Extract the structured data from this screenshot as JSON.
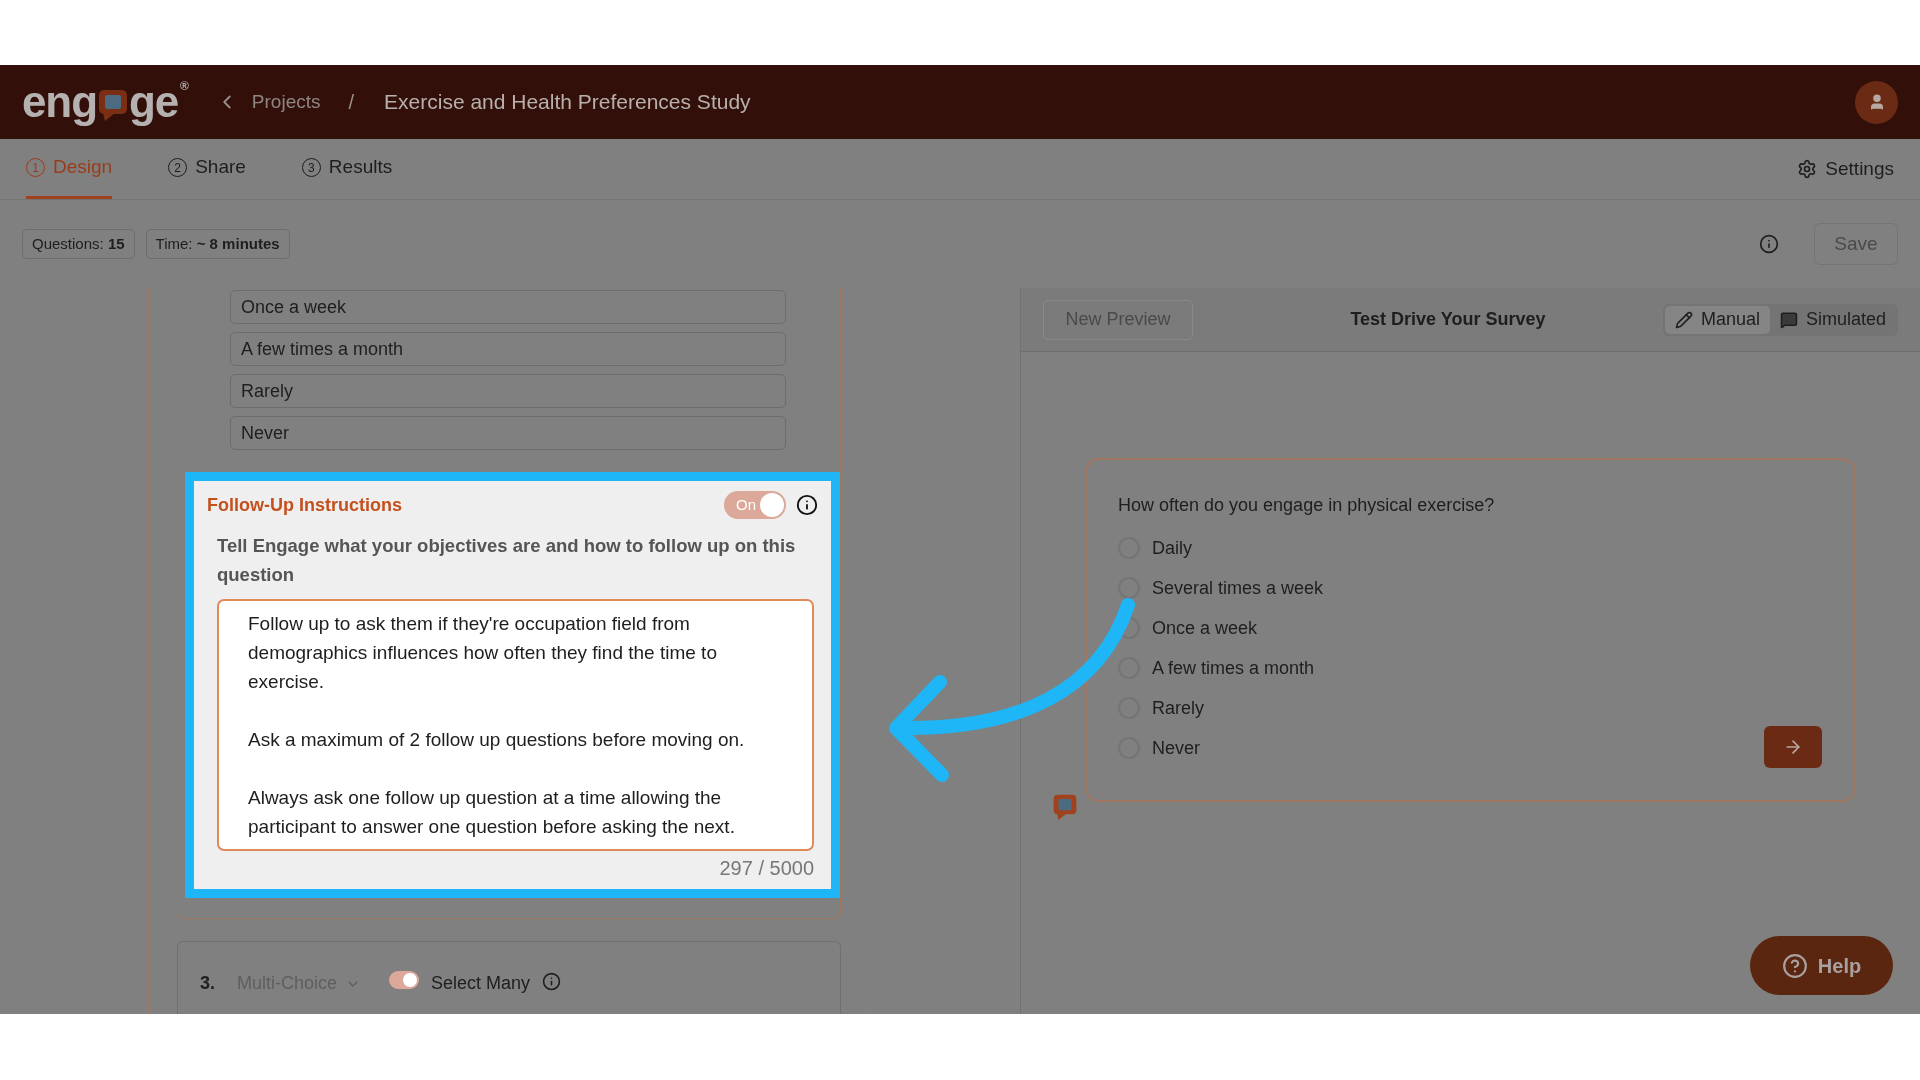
{
  "header": {
    "logo_parts": [
      "eng",
      "ge"
    ],
    "logo_mark": "®",
    "back_label": "Projects",
    "separator": "/",
    "title": "Exercise and Health Preferences Study"
  },
  "tabs": [
    {
      "number": "1",
      "label": "Design",
      "selected": true
    },
    {
      "number": "2",
      "label": "Share",
      "selected": false
    },
    {
      "number": "3",
      "label": "Results",
      "selected": false
    }
  ],
  "settings_label": "Settings",
  "stats": [
    "Questions: **15**",
    "Time: **~ 8 minutes**"
  ],
  "save": {
    "label": "Save",
    "disabled": true
  },
  "editor": {
    "options": [
      "Once a week",
      "A few times a month",
      "Rarely",
      "Never"
    ],
    "follow_up": {
      "title": "Follow-Up Instructions",
      "toggle": {
        "label": "On",
        "on": true
      },
      "description": "Tell Engage what your objectives are and how to follow up on this question",
      "value": "Follow up to ask them if they're occupation field from demographics influences how often they find the time to exercise.\n\nAsk a maximum of 2 follow up questions before moving on.\n\nAlways ask one follow up question at a time allowing the participant to answer one question before asking the next.",
      "counter": "297 / 5000"
    },
    "next_question": {
      "number": "3.",
      "type": "Multi-Choice",
      "toggle": {
        "on": true
      },
      "label": "Select Many"
    }
  },
  "preview": {
    "new_preview": {
      "label": "New Preview",
      "disabled": true
    },
    "title": "Test Drive Your Survey",
    "modes": [
      {
        "label": "Manual",
        "selected": true
      },
      {
        "label": "Simulated",
        "selected": false
      }
    ],
    "question": "How often do you engage in physical exercise?",
    "options": [
      {
        "label": "Daily",
        "selected": false
      },
      {
        "label": "Several times a week",
        "selected": false
      },
      {
        "label": "Once a week",
        "selected": false
      },
      {
        "label": "A few times a month",
        "selected": false
      },
      {
        "label": "Rarely",
        "selected": false
      },
      {
        "label": "Never",
        "selected": false
      }
    ]
  },
  "help_label": "Help"
}
